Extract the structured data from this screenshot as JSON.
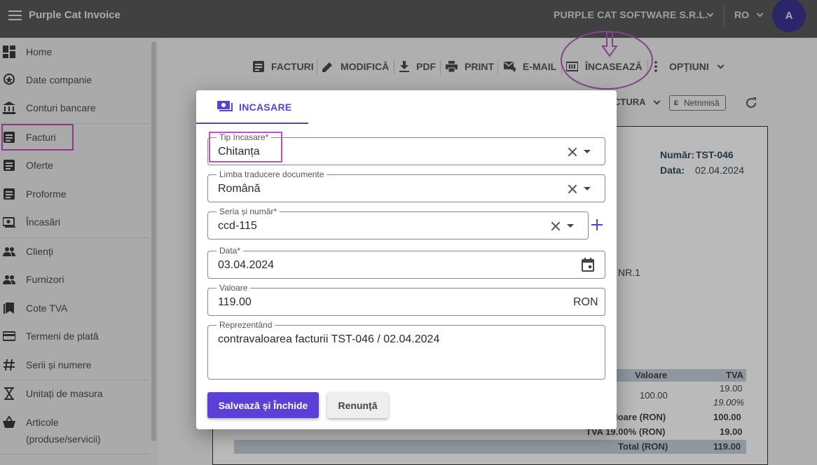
{
  "app": {
    "title": "Purple Cat Invoice",
    "company": "PURPLE CAT SOFTWARE S.R.L.",
    "language": "RO",
    "avatar_initial": "A"
  },
  "sidebar": {
    "items": [
      {
        "label": "Home",
        "icon": "dashboard-icon"
      },
      {
        "label": "Date companie",
        "icon": "badge-icon"
      },
      {
        "label": "Conturi bancare",
        "icon": "bank-icon"
      },
      {
        "label": "Facturi",
        "icon": "document-icon",
        "active": true
      },
      {
        "label": "Oferte",
        "icon": "document-icon"
      },
      {
        "label": "Proforme",
        "icon": "document-icon"
      },
      {
        "label": "Încasări",
        "icon": "payments-icon"
      },
      {
        "label": "Clienți",
        "icon": "people-icon"
      },
      {
        "label": "Furnizori",
        "icon": "people-icon"
      },
      {
        "label": "Cote TVA",
        "icon": "bookmark-icon"
      },
      {
        "label": "Termeni de plată",
        "icon": "card-icon"
      },
      {
        "label": "Serii și numere",
        "icon": "hash-icon"
      },
      {
        "label": "Unitați de masura",
        "icon": "hourglass-icon"
      },
      {
        "label": "Articole",
        "icon": "basket-icon"
      },
      {
        "label": "(produse/servicii)"
      }
    ]
  },
  "toolbar": {
    "facturi": "FACTURI",
    "modifica": "MODIFICĂ",
    "pdf": "PDF",
    "print": "PRINT",
    "email": "E-MAIL",
    "incaseaza": "ÎNCASEAZĂ",
    "optiuni": "OPȚIUNI"
  },
  "background": {
    "factura_dropdown": "CTURA",
    "status_chip": "Netrimisă",
    "status_chip_prefix": "E",
    "numar_label": "Număr:",
    "numar_value": "TST-046",
    "data_label": "Data:",
    "data_value": "02.04.2024",
    "address_fragment": "NR.1",
    "col_valoare": "Valoare",
    "col_tva": "TVA",
    "row_valoare": "100.00",
    "row_tva": "19.00",
    "row_tva_pct": "19.00%",
    "sum_valoare_label": "loare (RON)",
    "sum_valoare": "100.00",
    "sum_tva_label": "TVA 19.00% (RON)",
    "sum_tva": "19.00",
    "total_label": "Total (RON)",
    "total": "119.00"
  },
  "dialog": {
    "tab_label": "INCASARE",
    "fields": {
      "tip": {
        "label": "Tip încasare*",
        "value": "Chitanța"
      },
      "limba": {
        "label": "Limba traducere documente",
        "value": "Română"
      },
      "serie": {
        "label": "Seria și număr*",
        "value": "ccd-115"
      },
      "data": {
        "label": "Data*",
        "value": "03.04.2024"
      },
      "valoare": {
        "label": "Valoare",
        "value": "119.00",
        "suffix": "RON"
      },
      "reprezentand": {
        "label": "Reprezentând",
        "value": "contravaloarea facturii TST-046 / 02.04.2024"
      }
    },
    "save_button": "Salvează și Închide",
    "cancel_button": "Renunță"
  },
  "colors": {
    "accent": "#5b3fd6",
    "annotation": "#c24fc3",
    "topbar": "#5a5a5a"
  }
}
